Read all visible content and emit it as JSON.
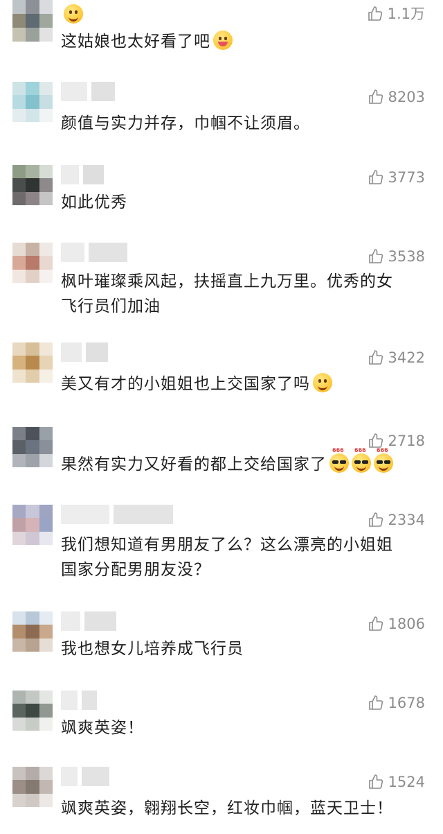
{
  "like_icon": "thumbs-up-outline-icon",
  "comments": [
    {
      "text": [
        "这姑娘也太好看了吧"
      ],
      "likes": "1.1万",
      "emoji_before_text": "smile",
      "emoji_after_text": [
        "tongue"
      ]
    },
    {
      "text": [
        "颜值与实力并存，巾帼不让须眉。"
      ],
      "likes": "8203",
      "emoji_after_text": []
    },
    {
      "text": [
        "如此优秀"
      ],
      "likes": "3773",
      "emoji_after_text": []
    },
    {
      "text": [
        "枫叶璀璨乘风起，扶摇直上九万里。优秀的女",
        "飞行员们加油"
      ],
      "likes": "3538",
      "emoji_after_text": []
    },
    {
      "text": [
        "美又有才的小姐姐也上交国家了吗"
      ],
      "likes": "3422",
      "emoji_after_text": [
        "grin"
      ]
    },
    {
      "text": [
        "果然有实力又好看的都上交给国家了"
      ],
      "likes": "2718",
      "emoji_after_text": [
        "cool-666",
        "cool-666",
        "cool-666"
      ]
    },
    {
      "text": [
        "我们想知道有男朋友了么？这么漂亮的小姐姐",
        "国家分配男朋友没？"
      ],
      "likes": "2334",
      "emoji_after_text": []
    },
    {
      "text": [
        "我也想女儿培养成飞行员"
      ],
      "likes": "1806",
      "emoji_after_text": []
    },
    {
      "text": [
        "飒爽英姿！"
      ],
      "likes": "1678",
      "emoji_after_text": []
    },
    {
      "text": [
        "飒爽英姿，翱翔长空，红妆巾帼，蓝天卫士！"
      ],
      "likes": "1524",
      "emoji_after_text": []
    }
  ],
  "emoji_badge_text": "666"
}
